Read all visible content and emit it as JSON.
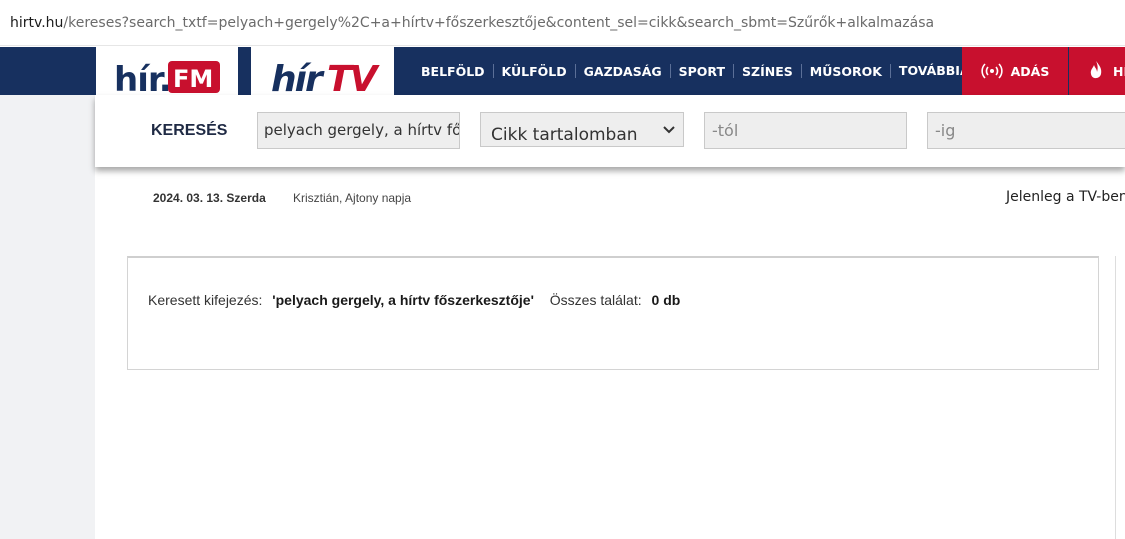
{
  "browser": {
    "url_host": "hirtv.hu",
    "url_path": "/kereses?search_txtf=pelyach+gergely%2C+a+hírtv+főszerkesztője&content_sel=cikk&search_sbmt=Szűrők+alkalmazása"
  },
  "nav": {
    "logo_fm": "hír.FM",
    "logo_tv": "hírTV",
    "menu": [
      "BELFÖLD",
      "KÜLFÖLD",
      "GAZDASÁG",
      "SPORT",
      "SZÍNES",
      "MŰSOROK",
      "TOVÁBBIAK"
    ],
    "live_label": "ADÁS",
    "news_label": "HÍ"
  },
  "search": {
    "label": "KERESÉS",
    "query": "pelyach gergely, a hírtv főszerkesztője",
    "scope": "Cikk tartalomban",
    "from_placeholder": "-tól",
    "to_placeholder": "-ig"
  },
  "date_row": {
    "date": "2024. 03. 13. Szerda",
    "nameday": "Krisztián, Ajtony napja",
    "now_on_tv": "Jelenleg a TV-ben:"
  },
  "results": {
    "searched_label": "Keresett kifejezés:",
    "searched_value": "'pelyach gergely, a hírtv főszerkesztője'",
    "total_label": "Összes találat:",
    "total_value": "0 db"
  },
  "colors": {
    "nav_bg": "#17305f",
    "accent_red": "#c8102e"
  }
}
